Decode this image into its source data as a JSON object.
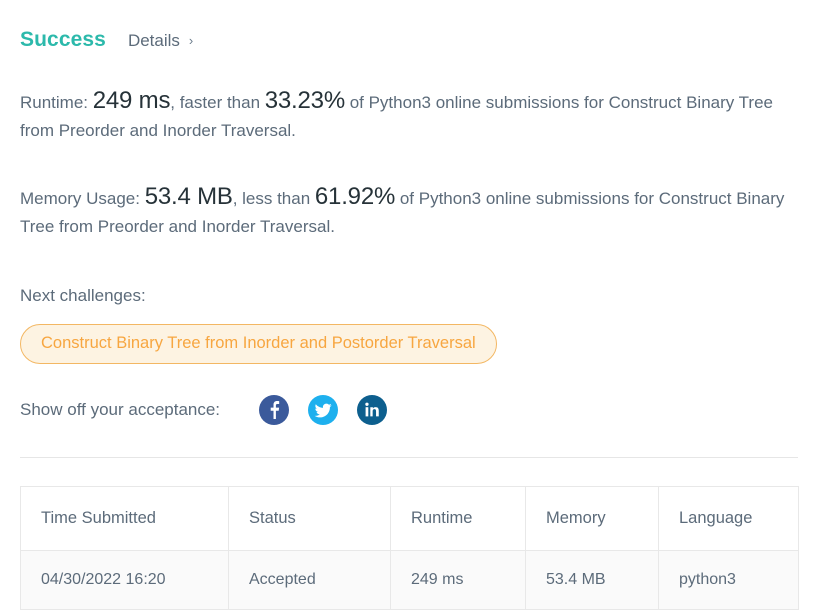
{
  "header": {
    "status_title": "Success",
    "details_label": "Details",
    "chevron": "›"
  },
  "runtime_stat": {
    "prefix": "Runtime: ",
    "value": "249 ms",
    "middle": ", faster than ",
    "percent": "33.23%",
    "suffix": " of Python3 online submissions for Construct Binary Tree from Preorder and Inorder Traversal."
  },
  "memory_stat": {
    "prefix": "Memory Usage: ",
    "value": "53.4 MB",
    "middle": ", less than ",
    "percent": "61.92%",
    "suffix": " of Python3 online submissions for Construct Binary Tree from Preorder and Inorder Traversal."
  },
  "next_challenges": {
    "label": "Next challenges:",
    "items": [
      "Construct Binary Tree from Inorder and Postorder Traversal"
    ]
  },
  "share": {
    "label": "Show off your acceptance:",
    "networks": [
      {
        "name": "facebook",
        "glyph": "f",
        "color": "#3b5a9b"
      },
      {
        "name": "twitter",
        "glyph": "bird",
        "color": "#1eb0ee"
      },
      {
        "name": "linkedin",
        "glyph": "in",
        "color": "#0d5f8e"
      }
    ]
  },
  "submissions_table": {
    "columns": [
      "Time Submitted",
      "Status",
      "Runtime",
      "Memory",
      "Language"
    ],
    "rows": [
      {
        "time": "04/30/2022 16:20",
        "status": "Accepted",
        "runtime": "249 ms",
        "memory": "53.4 MB",
        "language": "python3"
      }
    ]
  },
  "colors": {
    "accent_teal": "#2cb9ab",
    "body_text": "#5c6b7a",
    "emphasis_text": "#263238",
    "pill_border": "#f3b763",
    "pill_bg": "#fdf3e2",
    "pill_text": "#f7a640"
  }
}
